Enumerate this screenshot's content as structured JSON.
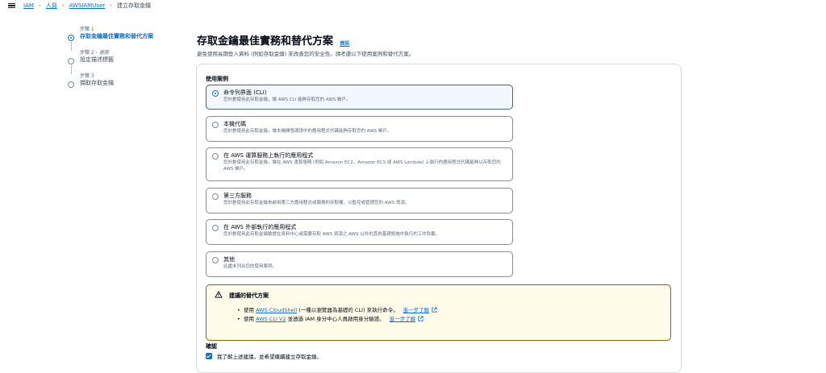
{
  "breadcrumb": {
    "items": [
      "IAM",
      "人員",
      "AWSIAMUser"
    ],
    "current": "建立存取金鑰"
  },
  "steps": [
    {
      "num": "步驟 1",
      "optional": "",
      "label": "存取金鑰最佳實務和替代方案",
      "active": true
    },
    {
      "num": "步驟 2 - ",
      "optional": "選用",
      "label": "設定描述標籤",
      "active": false
    },
    {
      "num": "步驟 3",
      "optional": "",
      "label": "擷取存取金鑰",
      "active": false
    }
  ],
  "main": {
    "title": "存取金鑰最佳實務和替代方案",
    "info_label": "資訊",
    "description": "避免使用長期登入資料 (例如存取金鑰) 來改善您的安全性。請考慮以下使用案例和替代方案。",
    "use_case_label": "使用案例"
  },
  "options": [
    {
      "title": "命令列界面 (CLI)",
      "desc": "您計劃使用此存取金鑰，讓 AWS CLI 能夠存取您的 AWS 帳戶。",
      "selected": true
    },
    {
      "title": "本機代碼",
      "desc": "您計劃使用此存取金鑰，讓本機開發環境中的應用程式代碼能夠存取您的 AWS 帳戶。",
      "selected": false
    },
    {
      "title": "在 AWS 運算服務上執行的應用程式",
      "desc": "您計劃使用此存取金鑰，讓在 AWS 運算服務 (例如 Amazon EC2、Amazon ECS 或 AWS Lambda) 上執行的應用程式代碼能夠以存取您的 AWS 帳戶。",
      "selected": false
    },
    {
      "title": "第三方服務",
      "desc": "您計劃使用此存取金鑰來啟用第三方應用程式或服務的存取權，以監控或管理您的 AWS 資源。",
      "selected": false
    },
    {
      "title": "在 AWS 外部執行的應用程式",
      "desc": "您計劃使用此存取金鑰驗證在資料中心或需要存取 AWS 資源之 AWS 以外的其他基礎設施中執行的工作負載。",
      "selected": false
    },
    {
      "title": "其他",
      "desc": "此處未列出您的使用案例。",
      "selected": false
    }
  ],
  "alert": {
    "title": "建議的替代方案",
    "items": [
      {
        "pre": "使用 ",
        "link": "AWS CloudShell",
        "post": " (一種以瀏覽器為基礎的 CLI) 來執行命令。",
        "learn": "進一步了解"
      },
      {
        "pre": "使用 ",
        "link": "AWS CLI V2",
        "post": " 並透過 IAM 身分中心人員啟用身分驗證。",
        "learn": "進一步了解"
      }
    ]
  },
  "confirm": {
    "label": "確認",
    "text": "我了解上述建議，並希望繼續建立存取金鑰。",
    "checked": true
  },
  "colors": {
    "accent": "#0972d3",
    "warning_border": "#8d6605",
    "warning_bg": "#fffce9"
  }
}
